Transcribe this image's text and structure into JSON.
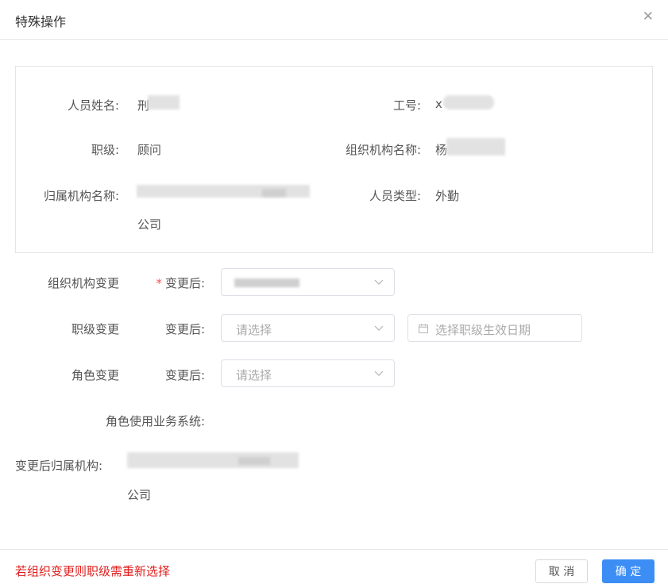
{
  "modal": {
    "title": "特殊操作",
    "close_icon": "close-icon"
  },
  "info": {
    "name_label": "人员姓名:",
    "name_value_visible": "刑",
    "job_no_label": "工号:",
    "job_no_value_visible": "x",
    "rank_label": "职级:",
    "rank_value": "顾问",
    "org_name_label": "组织机构名称:",
    "org_name_value_visible": "杨",
    "affil_org_label": "归属机构名称:",
    "affil_org_value_tail": "公司",
    "staff_type_label": "人员类型:",
    "staff_type_value": "外勤"
  },
  "changes": {
    "org_change": {
      "section": "组织机构变更",
      "required_mark": "*",
      "after_label": "变更后:"
    },
    "rank_change": {
      "section": "职级变更",
      "after_label": "变更后:",
      "placeholder": "请选择",
      "date_placeholder": "选择职级生效日期"
    },
    "role_change": {
      "section": "角色变更",
      "after_label": "变更后:",
      "placeholder": "请选择"
    },
    "role_systems_label": "角色使用业务系统:",
    "after_affil_label": "变更后归属机构:",
    "after_affil_value_tail": "公司"
  },
  "footer": {
    "warning": "若组织变更则职级需重新选择",
    "cancel_label": "取 消",
    "ok_label": "确 定"
  },
  "colors": {
    "primary": "#3c8ef5",
    "warning": "#e02020",
    "required": "#ff4d4f",
    "border": "#dcdfe6"
  }
}
